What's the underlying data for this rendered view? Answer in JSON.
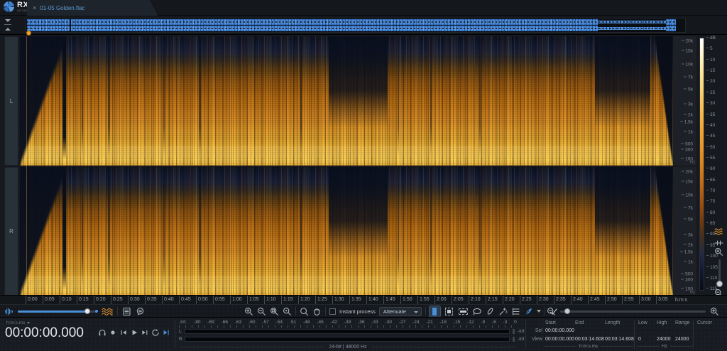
{
  "app": {
    "logo": "RX",
    "logo_sub": "ADVANCED",
    "tab_close": "×",
    "tab_title": "01-05 Golden.flac"
  },
  "spectrogram": {
    "channel_labels": [
      "L",
      "R"
    ],
    "freq_ticks": [
      "20k",
      "15k",
      "10k",
      "7k",
      "5k",
      "3k",
      "2k",
      "1.5k",
      "1k",
      "500",
      "300",
      "100"
    ],
    "freq_unit": "Hz",
    "db_header": "dB",
    "db_ticks": [
      "5",
      "10",
      "15",
      "20",
      "25",
      "30",
      "35",
      "40",
      "45",
      "50",
      "55",
      "60",
      "65",
      "70",
      "75",
      "80",
      "85",
      "90",
      "95",
      "100",
      "105",
      "110",
      "115"
    ]
  },
  "time_ruler": {
    "ticks": [
      "0:00",
      "0:05",
      "0:10",
      "0:15",
      "0:20",
      "0:25",
      "0:30",
      "0:35",
      "0:40",
      "0:45",
      "0:50",
      "0:55",
      "1:00",
      "1:05",
      "1:10",
      "1:15",
      "1:20",
      "1:25",
      "1:30",
      "1:35",
      "1:40",
      "1:45",
      "1:50",
      "1:55",
      "2:00",
      "2:05",
      "2:10",
      "2:15",
      "2:20",
      "2:25",
      "2:30",
      "2:35",
      "2:40",
      "2:45",
      "2:50",
      "2:55",
      "3:00",
      "3:05"
    ],
    "unit": "h:m:s"
  },
  "toolbar": {
    "instant_process_label": "Instant process",
    "module_selected": "Attenuate"
  },
  "transport": {
    "time_format": "h:m:s.ms",
    "time_display": "00:00:00.000"
  },
  "meters": {
    "scale": [
      "-Inf.",
      "-80",
      "-69",
      "-66",
      "-63",
      "-60",
      "-57",
      "-54",
      "-51",
      "-48",
      "-45",
      "-42",
      "-39",
      "-36",
      "-33",
      "-30",
      "-27",
      "-24",
      "-21",
      "-18",
      "-15",
      "-12",
      "-9",
      "-6",
      "-3",
      "0"
    ],
    "left_label": "L",
    "right_label": "R",
    "left_readout": "-Inf",
    "right_readout": "-Inf",
    "file_info": "24-bit | 48000 Hz"
  },
  "selection": {
    "headers": {
      "start": "Start",
      "end": "End",
      "length": "Length",
      "low": "Low",
      "high": "High",
      "range": "Range",
      "cursor": "Cursor"
    },
    "sel_label": "Sel",
    "view_label": "View",
    "sel": {
      "start": "00:00:00.000"
    },
    "view": {
      "start": "00:00:00.000",
      "end": "00:03:14.608",
      "length": "00:03:14.608",
      "low": "0",
      "high": "24000",
      "range": "24000"
    },
    "time_unit": "h:m:s.ms",
    "freq_unit": "Hz"
  },
  "colors": {
    "accent_blue": "#4a90d9",
    "waveform_blue": "#4f93e8",
    "spectrogram_orange": "#e09a28"
  }
}
